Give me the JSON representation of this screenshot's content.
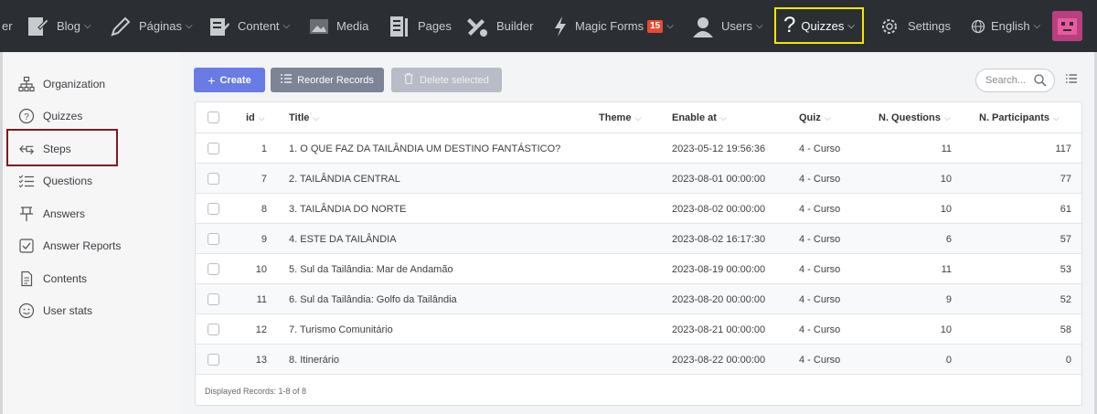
{
  "topnav": {
    "items": [
      {
        "label": "Blog",
        "icon": "blog-icon"
      },
      {
        "label": "Páginas",
        "icon": "pencil-icon"
      },
      {
        "label": "Content",
        "icon": "content-icon"
      },
      {
        "label": "Media",
        "icon": "media-icon"
      },
      {
        "label": "Pages",
        "icon": "pages-icon"
      },
      {
        "label": "Builder",
        "icon": "builder-icon"
      },
      {
        "label": "Magic Forms",
        "icon": "bolt-icon",
        "badge": "15"
      },
      {
        "label": "Users",
        "icon": "user-icon"
      },
      {
        "label": "Quizzes",
        "icon": "question-icon"
      },
      {
        "label": "Settings",
        "icon": "gear-icon"
      },
      {
        "label": "English",
        "icon": "globe-icon"
      }
    ],
    "left_fragment": "er"
  },
  "sidebar": {
    "items": [
      {
        "label": "Organization",
        "icon": "org-chart-icon"
      },
      {
        "label": "Quizzes",
        "icon": "question-circle-icon"
      },
      {
        "label": "Steps",
        "icon": "steps-icon"
      },
      {
        "label": "Questions",
        "icon": "checklist-icon"
      },
      {
        "label": "Answers",
        "icon": "answers-icon"
      },
      {
        "label": "Answer Reports",
        "icon": "check-square-icon"
      },
      {
        "label": "Contents",
        "icon": "document-icon"
      },
      {
        "label": "User stats",
        "icon": "smiley-icon"
      }
    ]
  },
  "toolbar": {
    "create_label": "Create",
    "reorder_label": "Reorder Records",
    "delete_label": "Delete selected",
    "search_placeholder": "Search..."
  },
  "table": {
    "headers": [
      "id",
      "Title",
      "Theme",
      "Enable at",
      "Quiz",
      "N. Questions",
      "N. Participants"
    ],
    "rows": [
      {
        "id": "1",
        "title": "1. O QUE FAZ DA TAILÂNDIA UM DESTINO FANTÁSTICO?",
        "theme": "",
        "enable_at": "2023-05-12 19:56:36",
        "quiz": "4 - Curso",
        "questions": "11",
        "participants": "117"
      },
      {
        "id": "7",
        "title": "2. TAILÂNDIA CENTRAL",
        "theme": "",
        "enable_at": "2023-08-01 00:00:00",
        "quiz": "4 - Curso",
        "questions": "10",
        "participants": "77"
      },
      {
        "id": "8",
        "title": "3. TAILÂNDIA DO NORTE",
        "theme": "",
        "enable_at": "2023-08-02 00:00:00",
        "quiz": "4 - Curso",
        "questions": "10",
        "participants": "61"
      },
      {
        "id": "9",
        "title": "4. ESTE DA TAILÂNDIA",
        "theme": "",
        "enable_at": "2023-08-02 16:17:30",
        "quiz": "4 - Curso",
        "questions": "6",
        "participants": "57"
      },
      {
        "id": "10",
        "title": "5. Sul da Tailândia: Mar de Andamão",
        "theme": "",
        "enable_at": "2023-08-19 00:00:00",
        "quiz": "4 - Curso",
        "questions": "11",
        "participants": "53"
      },
      {
        "id": "11",
        "title": "6. Sul da Tailândia: Golfo da Tailândia",
        "theme": "",
        "enable_at": "2023-08-20 00:00:00",
        "quiz": "4 - Curso",
        "questions": "9",
        "participants": "52"
      },
      {
        "id": "12",
        "title": "7. Turismo Comunitário",
        "theme": "",
        "enable_at": "2023-08-21 00:00:00",
        "quiz": "4 - Curso",
        "questions": "10",
        "participants": "58"
      },
      {
        "id": "13",
        "title": "8. Itinerário",
        "theme": "",
        "enable_at": "2023-08-22 00:00:00",
        "quiz": "4 - Curso",
        "questions": "0",
        "participants": "0"
      }
    ],
    "footer": "Displayed Records: 1-8 of 8"
  },
  "colors": {
    "nav_bg": "#2b2f33",
    "highlight_yellow": "#f5e600",
    "highlight_red": "#7b1c22",
    "create_button": "#6a7be6",
    "reorder_button": "#7c8495",
    "delete_button": "#b7bcc6"
  }
}
